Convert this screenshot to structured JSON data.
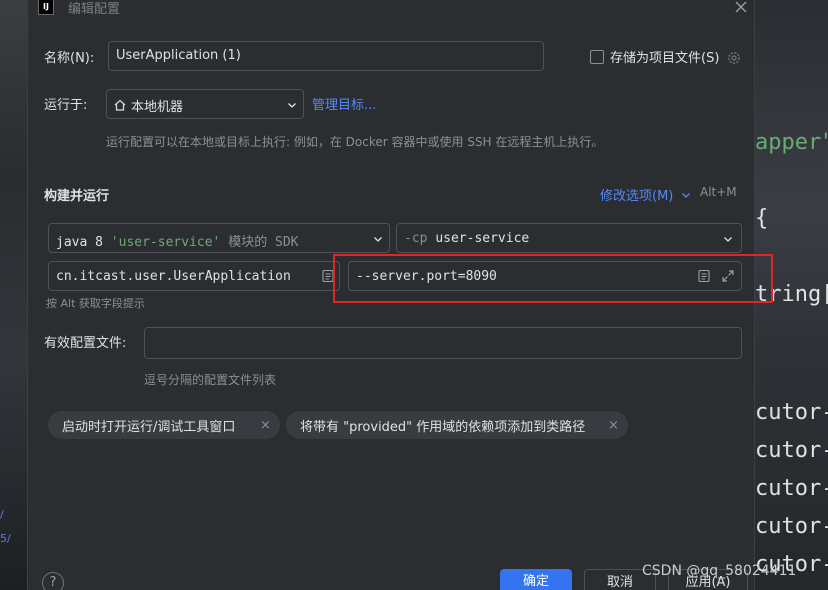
{
  "background": {
    "left_text": [
      "/",
      "5/"
    ],
    "right_code": [
      "apper\"",
      "{",
      "tring[",
      "cutor-",
      "cutor-",
      "cutor-",
      "cutor-",
      "cutor-"
    ]
  },
  "dialog": {
    "title": "编辑配置",
    "name_label": "名称(N):",
    "name_value": "UserApplication (1)",
    "store_as_project_file": "存储为项目文件(S)",
    "run_on_label": "运行于:",
    "run_on_value": "本地机器",
    "manage_targets": "管理目标...",
    "run_on_hint": "运行配置可以在本地或目标上执行: 例如，在 Docker 容器中或使用 SSH 在远程主机上执行。",
    "build_run_header": "构建并运行",
    "modify_options": "修改选项(M)",
    "modify_shortcut": "Alt+M",
    "sdk_jdk": "java 8",
    "sdk_module": "'user-service'",
    "sdk_suffix": "模块的 SDK",
    "cp_flag": "-cp",
    "cp_module": "user-service",
    "main_class": "cn.itcast.user.UserApplication",
    "program_args": "--server.port=8090",
    "alt_hint": "按 Alt 获取字段提示",
    "active_profiles_label": "有效配置文件:",
    "active_profiles_value": "",
    "profiles_hint": "逗号分隔的配置文件列表",
    "chips": [
      "启动时打开运行/调试工具窗口",
      "将带有 \"provided\" 作用域的依赖项添加到类路径"
    ],
    "help": "?",
    "ok_button": "确定",
    "cancel_button": "取消",
    "apply_button": "应用(A)"
  },
  "watermark": "CSDN @qq_58024411",
  "colors": {
    "dialog_bg": "#2b2d30",
    "field_border": "#4e5157",
    "link": "#548af7",
    "primary_button": "#3574f0",
    "highlight_box": "#e0262a",
    "code_green": "#6aab73",
    "code_white": "#dfe1e5"
  }
}
